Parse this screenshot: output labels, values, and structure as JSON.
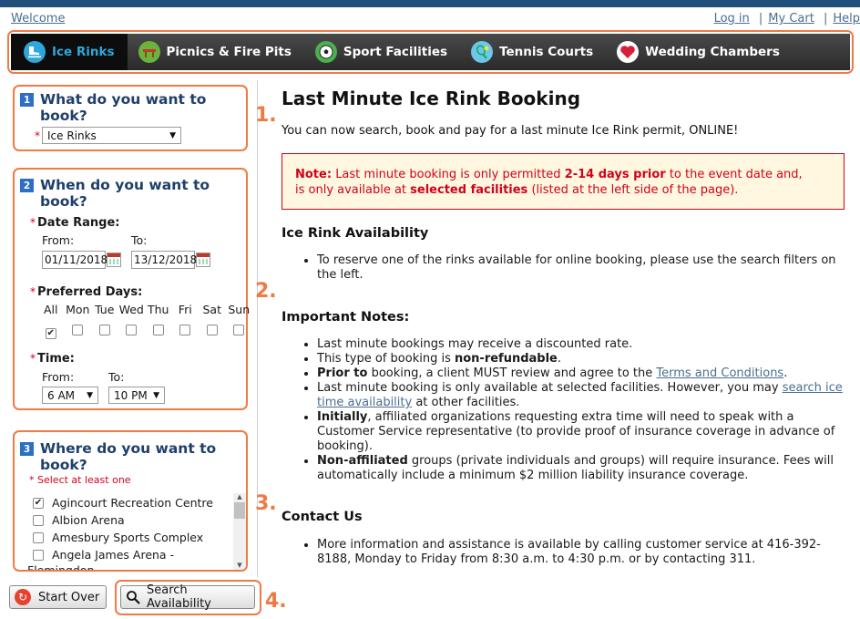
{
  "header": {
    "welcome": "Welcome",
    "login": "Log in",
    "my_cart": "My Cart",
    "help": "Help"
  },
  "nav": {
    "items": [
      {
        "label": "Ice Rinks",
        "icon": "skate-icon"
      },
      {
        "label": "Picnics & Fire Pits",
        "icon": "picnic-icon"
      },
      {
        "label": "Sport Facilities",
        "icon": "soccer-ball-icon"
      },
      {
        "label": "Tennis Courts",
        "icon": "tennis-icon"
      },
      {
        "label": "Wedding Chambers",
        "icon": "heart-icon"
      }
    ],
    "active_color": "#2ea8dc"
  },
  "steps": {
    "s1": "1.",
    "s2": "2.",
    "s3": "3.",
    "s4": "4."
  },
  "section1": {
    "num": "1",
    "title_line1": "What do you want to",
    "title_line2": "book?",
    "select_value": "Ice Rinks"
  },
  "section2": {
    "num": "2",
    "title_line1": "When do you want to",
    "title_line2": "book?",
    "date_range_label": "Date Range:",
    "from_label": "From:",
    "to_label": "To:",
    "from_value": "01/11/2018",
    "to_value": "13/12/2018",
    "days_label": "Preferred Days:",
    "days": [
      {
        "label": "All",
        "checked": true
      },
      {
        "label": "Mon",
        "checked": false
      },
      {
        "label": "Tue",
        "checked": false
      },
      {
        "label": "Wed",
        "checked": false
      },
      {
        "label": "Thu",
        "checked": false
      },
      {
        "label": "Fri",
        "checked": false
      },
      {
        "label": "Sat",
        "checked": false
      },
      {
        "label": "Sun",
        "checked": false
      }
    ],
    "time_label": "Time:",
    "time_from_label": "From:",
    "time_to_label": "To:",
    "time_from_value": "6 AM",
    "time_to_value": "10 PM"
  },
  "section3": {
    "num": "3",
    "title_line1": "Where do you want to",
    "title_line2": "book?",
    "hint": "Select at least one",
    "facilities": [
      {
        "label": "Agincourt Recreation Centre",
        "checked": true
      },
      {
        "label": "Albion Arena",
        "checked": false
      },
      {
        "label": "Amesbury Sports Complex",
        "checked": false
      },
      {
        "label": "Angela James Arena -",
        "checked": false
      },
      {
        "label": "Flemingdon",
        "checked": false
      }
    ]
  },
  "buttons": {
    "start_over": "Start Over",
    "search": "Search Availability"
  },
  "main": {
    "title": "Last Minute Ice Rink Booking",
    "intro": "You can now search, book and pay for a last minute Ice Rink permit, ONLINE!",
    "note_prefix": "Note:",
    "note_t1": "Last minute booking is only permitted",
    "note_b1": "2-14 days prior",
    "note_t2": "to the event date and,",
    "note_t3": "is only available at",
    "note_b2": "selected facilities",
    "note_t4": "(listed at the left side of the page).",
    "avail_heading": "Ice Rink Availability",
    "avail_item": "To reserve one of the rinks available for online booking, please use the search filters on the left.",
    "notes_heading": "Important Notes:",
    "n1": "Last minute bookings may receive a discounted rate.",
    "n2_t": "This type of booking is",
    "n2_b": "non-refundable",
    "n2_end": ".",
    "n3_b": "Prior to",
    "n3_t": "booking, a client MUST review and agree to the",
    "n3_link": "Terms and Conditions",
    "n3_end": ".",
    "n4_t": "Last minute booking is only available at selected facilities. However, you may",
    "n4_link": "search ice time availability",
    "n4_end": "at other facilities.",
    "n5_b": "Initially",
    "n5_t": ", affiliated organizations requesting extra time will need to speak with a Customer Service representative (to provide proof of insurance coverage in advance of booking).",
    "n6_b": "Non-affiliated",
    "n6_t": "groups (private individuals and groups) will require insurance. Fees will automatically include a minimum $2 million liability insurance coverage.",
    "contact_heading": "Contact Us",
    "contact_item": "More information and assistance is available by calling customer service at 416-392-8188, Monday to Friday from 8:30 a.m. to 4:30 p.m. or by contacting 311."
  }
}
